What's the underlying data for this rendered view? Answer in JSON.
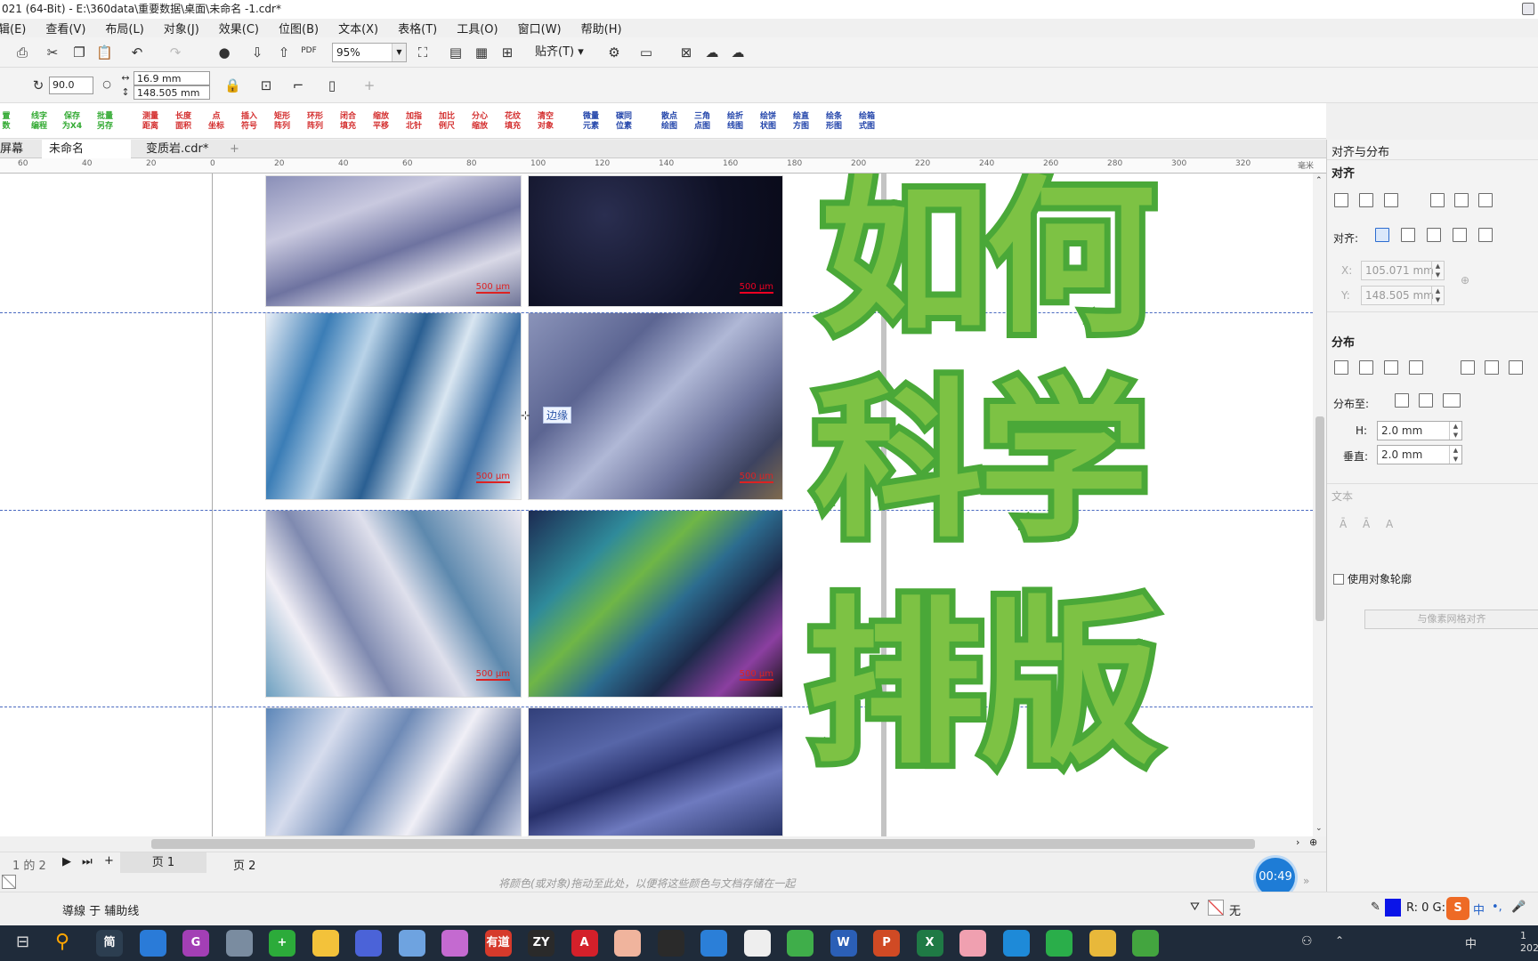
{
  "window": {
    "title": "021 (64-Bit) - E:\\360data\\重要数据\\桌面\\未命名 -1.cdr*"
  },
  "menu": [
    "辑(E)",
    "查看(V)",
    "布局(L)",
    "对象(J)",
    "效果(C)",
    "位图(B)",
    "文本(X)",
    "表格(T)",
    "工具(O)",
    "窗口(W)",
    "帮助(H)"
  ],
  "toolbar": {
    "zoom": "95%",
    "snap_label": "贴齐(T)",
    "pdf_label": "PDF"
  },
  "propbar": {
    "rotation": "90.0",
    "width": "16.9 mm",
    "height": "148.505 mm"
  },
  "macros": [
    {
      "label": "置\n数",
      "color": "green"
    },
    {
      "label": "线字\n编程",
      "color": "green"
    },
    {
      "label": "保存\n为X4",
      "color": "green"
    },
    {
      "label": "批量\n另存",
      "color": "green"
    },
    {
      "label": "测量\n距离",
      "color": "red"
    },
    {
      "label": "长度\n面积",
      "color": "red"
    },
    {
      "label": "点\n坐标",
      "color": "red"
    },
    {
      "label": "插入\n符号",
      "color": "red"
    },
    {
      "label": "矩形\n阵列",
      "color": "red"
    },
    {
      "label": "环形\n阵列",
      "color": "red"
    },
    {
      "label": "闭合\n填充",
      "color": "red"
    },
    {
      "label": "缩放\n平移",
      "color": "red"
    },
    {
      "label": "加指\n北针",
      "color": "red"
    },
    {
      "label": "加比\n例尺",
      "color": "red"
    },
    {
      "label": "分心\n缩放",
      "color": "red"
    },
    {
      "label": "花纹\n填充",
      "color": "red"
    },
    {
      "label": "清空\n对象",
      "color": "red"
    },
    {
      "label": "微量\n元素",
      "color": "blue"
    },
    {
      "label": "碳同\n位素",
      "color": "blue"
    },
    {
      "label": "散点\n绘图",
      "color": "blue"
    },
    {
      "label": "三角\n点图",
      "color": "blue"
    },
    {
      "label": "绘折\n线图",
      "color": "blue"
    },
    {
      "label": "绘饼\n状图",
      "color": "blue"
    },
    {
      "label": "绘直\n方图",
      "color": "blue"
    },
    {
      "label": "绘条\n形图",
      "color": "blue"
    },
    {
      "label": "绘箱\n式图",
      "color": "blue"
    }
  ],
  "tabs": [
    "屏幕",
    "未命名 -1.cdr*",
    "变质岩.cdr*"
  ],
  "ruler": {
    "unit": "毫米",
    "ticks": [
      "60",
      "40",
      "20",
      "0",
      "20",
      "40",
      "60",
      "80",
      "100",
      "120",
      "140",
      "160",
      "180",
      "200",
      "220",
      "240",
      "260",
      "280",
      "300",
      "320"
    ]
  },
  "canvas": {
    "title_chars": [
      "如何",
      "科学",
      "排版"
    ],
    "tooltip": "边缘",
    "scale_labels": [
      "500 μm",
      "500 μm"
    ]
  },
  "pagebar": {
    "page_counter": "1 的 2",
    "pages": [
      "页 1",
      "页 2"
    ]
  },
  "palette_hint": "将颜色(或对象)拖动至此处，以便将这些颜色与文档存储在一起",
  "status": {
    "text": "導線 于 辅助线",
    "fill_label": "无",
    "color_readout": "R: 0 G:"
  },
  "timer": "00:49",
  "docker": {
    "title": "对齐与分布",
    "align_header": "对齐",
    "align_to_label": "对齐:",
    "x_label": "X:",
    "x_value": "105.071 mm",
    "y_label": "Y:",
    "y_value": "148.505 mm",
    "distribute_header": "分布",
    "distribute_to_label": "分布至:",
    "h_label": "H:",
    "h_value": "2.0 mm",
    "v_label": "垂直:",
    "v_value": "2.0 mm",
    "text_header": "文本",
    "outline_checkbox": "使用对象轮廓",
    "pixel_align_button": "与像素网格对齐"
  },
  "taskbar": {
    "ime": "中",
    "clock": "1\n202"
  },
  "colors": {
    "accent_green": "#7dc244",
    "green_outline": "#4aa838",
    "timer_blue": "#1e7cd6",
    "taskbar": "#1f2b3a"
  }
}
